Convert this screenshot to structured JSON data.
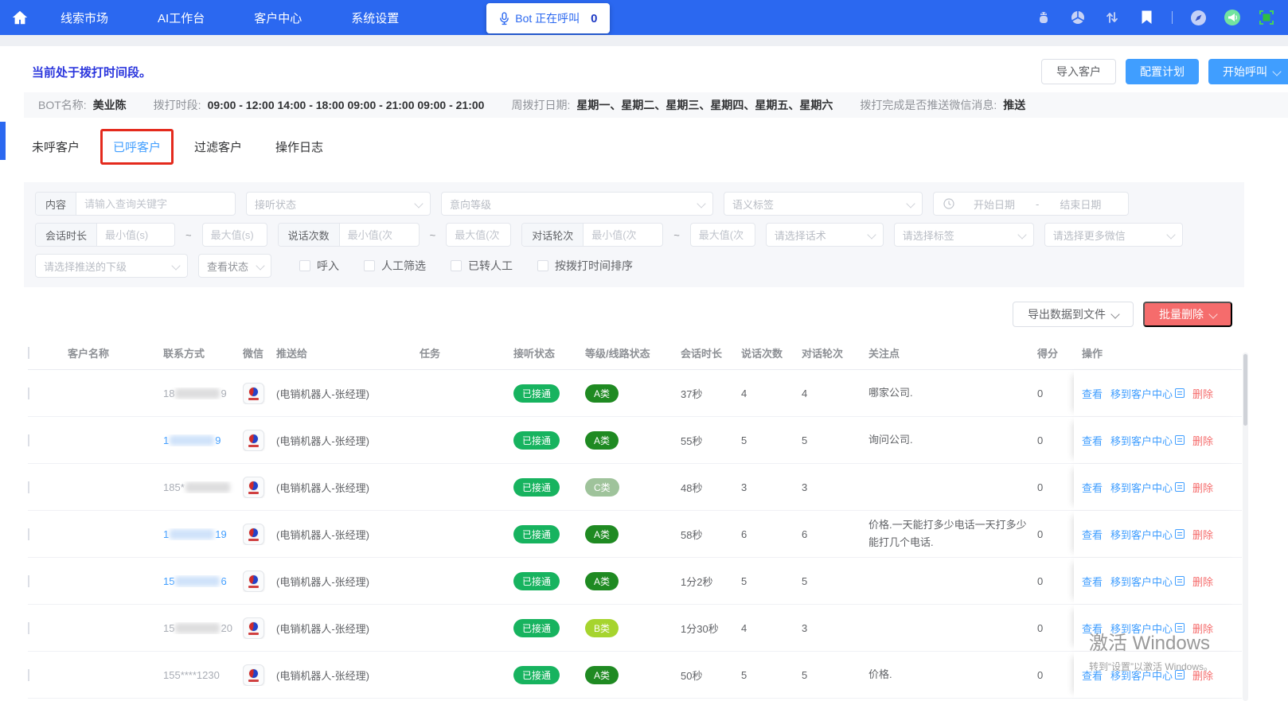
{
  "colors": {
    "nav_blue": "#2b68f0",
    "primary": "#409eff",
    "danger": "#f56c6c",
    "status_text_blue": "#2b36dd",
    "answered_green": "#17b35f",
    "grade_a_green": "#1f8a22",
    "grade_b_green": "#a6d42e",
    "grade_c_green": "#9fc39b"
  },
  "nav": {
    "items": [
      "线索市场",
      "AI工作台",
      "客户中心",
      "系统设置"
    ],
    "bot_button": {
      "label": "Bot 正在呼叫",
      "count": "0"
    },
    "right_icons": [
      "robot-icon",
      "aperture-icon",
      "sort-arrows-icon",
      "bookmark-icon",
      "compass-icon",
      "megaphone-icon",
      "fullscreen-icon"
    ]
  },
  "header": {
    "status_text": "当前处于拨打时间段。",
    "import_label": "导入客户",
    "configure_label": "配置计划",
    "start_label": "开始呼叫"
  },
  "info_bar": {
    "fields": [
      {
        "label": "BOT名称:",
        "value": "美业陈"
      },
      {
        "label": "拨打时段:",
        "value": "09:00 - 12:00 14:00 - 18:00 09:00 - 21:00 09:00 - 21:00"
      },
      {
        "label": "周拨打日期:",
        "value": "星期一、星期二、星期三、星期四、星期五、星期六"
      },
      {
        "label": "拨打完成是否推送微信消息:",
        "value": "推送"
      }
    ]
  },
  "tabs": [
    "未呼客户",
    "已呼客户",
    "过滤客户",
    "操作日志"
  ],
  "active_tab_index": 1,
  "filters": {
    "content_label": "内容",
    "keyword_placeholder": "请输入查询关键字",
    "answer_status": "接听状态",
    "intent_level": "意向等级",
    "semantic_tag": "语义标签",
    "start_date": "开始日期",
    "date_sep": "-",
    "end_date": "结束日期",
    "duration_label": "会话时长",
    "duration_min": "最小值(s)",
    "duration_max": "最大值(s)",
    "speak_label": "说话次数",
    "speak_min": "最小值(次",
    "speak_max": "最大值(次",
    "turns_label": "对话轮次",
    "turns_min": "最小值(次",
    "turns_max": "最大值(次",
    "tilde": "~",
    "script_select": "请选择话术",
    "tag_select": "请选择标签",
    "more_wechat_select": "请选择更多微信",
    "subordinate_select": "请选择推送的下级",
    "view_status_select": "查看状态",
    "checkboxes": [
      "呼入",
      "人工筛选",
      "已转人工",
      "按拨打时间排序"
    ]
  },
  "toolbar": {
    "export_label": "导出数据到文件",
    "batch_delete_label": "批量删除"
  },
  "table": {
    "columns": [
      "客户名称",
      "联系方式",
      "微信",
      "推送给",
      "任务",
      "接听状态",
      "等级/线路状态",
      "会话时长",
      "说话次数",
      "对话轮次",
      "关注点",
      "得分",
      "操作"
    ],
    "rows": [
      {
        "name": "",
        "phone_prefix": "18",
        "phone_suffix": "9",
        "phone_link": false,
        "blur": true,
        "pushed_to": "(电销机器人-张经理)",
        "task": "",
        "answered": "已接通",
        "grade": "A类",
        "grade_color": "#1f8a22",
        "duration": "37秒",
        "speak": "4",
        "turns": "4",
        "focus": "哪家公司.",
        "score": "0"
      },
      {
        "name": "",
        "phone_prefix": "1",
        "phone_suffix": "9",
        "phone_link": true,
        "blur": true,
        "pushed_to": "(电销机器人-张经理)",
        "task": "",
        "answered": "已接通",
        "grade": "A类",
        "grade_color": "#1f8a22",
        "duration": "55秒",
        "speak": "5",
        "turns": "5",
        "focus": "询问公司.",
        "score": "0"
      },
      {
        "name": "",
        "phone_prefix": "185*",
        "phone_suffix": "",
        "phone_link": false,
        "blur": true,
        "pushed_to": "(电销机器人-张经理)",
        "task": "",
        "answered": "已接通",
        "grade": "C类",
        "grade_color": "#9fc39b",
        "duration": "48秒",
        "speak": "3",
        "turns": "3",
        "focus": "",
        "score": "0"
      },
      {
        "name": "",
        "phone_prefix": "1",
        "phone_suffix": "19",
        "phone_link": true,
        "blur": true,
        "pushed_to": "(电销机器人-张经理)",
        "task": "",
        "answered": "已接通",
        "grade": "A类",
        "grade_color": "#1f8a22",
        "duration": "58秒",
        "speak": "6",
        "turns": "6",
        "focus": "价格.一天能打多少电话一天打多少能打几个电话.",
        "score": "0"
      },
      {
        "name": "",
        "phone_prefix": "15",
        "phone_suffix": "6",
        "phone_link": true,
        "blur": true,
        "pushed_to": "(电销机器人-张经理)",
        "task": "",
        "answered": "已接通",
        "grade": "A类",
        "grade_color": "#1f8a22",
        "duration": "1分2秒",
        "speak": "5",
        "turns": "5",
        "focus": "",
        "score": "0"
      },
      {
        "name": "",
        "phone_prefix": "15",
        "phone_suffix": "20",
        "phone_link": false,
        "blur": true,
        "pushed_to": "(电销机器人-张经理)",
        "task": "",
        "answered": "已接通",
        "grade": "B类",
        "grade_color": "#a6d42e",
        "duration": "1分30秒",
        "speak": "4",
        "turns": "3",
        "focus": "",
        "score": "0"
      },
      {
        "name": "",
        "phone_prefix": "155****1230",
        "phone_suffix": "",
        "phone_link": false,
        "blur": false,
        "pushed_to": "(电销机器人-张经理)",
        "task": "",
        "answered": "已接通",
        "grade": "A类",
        "grade_color": "#1f8a22",
        "duration": "50秒",
        "speak": "5",
        "turns": "5",
        "focus": "价格.",
        "score": "0"
      }
    ]
  },
  "row_actions": {
    "view": "查看",
    "move": "移到客户中心",
    "delete": "删除"
  },
  "watermark": {
    "title": "激活 Windows",
    "subtitle": "转到“设置”以激活 Windows。"
  }
}
